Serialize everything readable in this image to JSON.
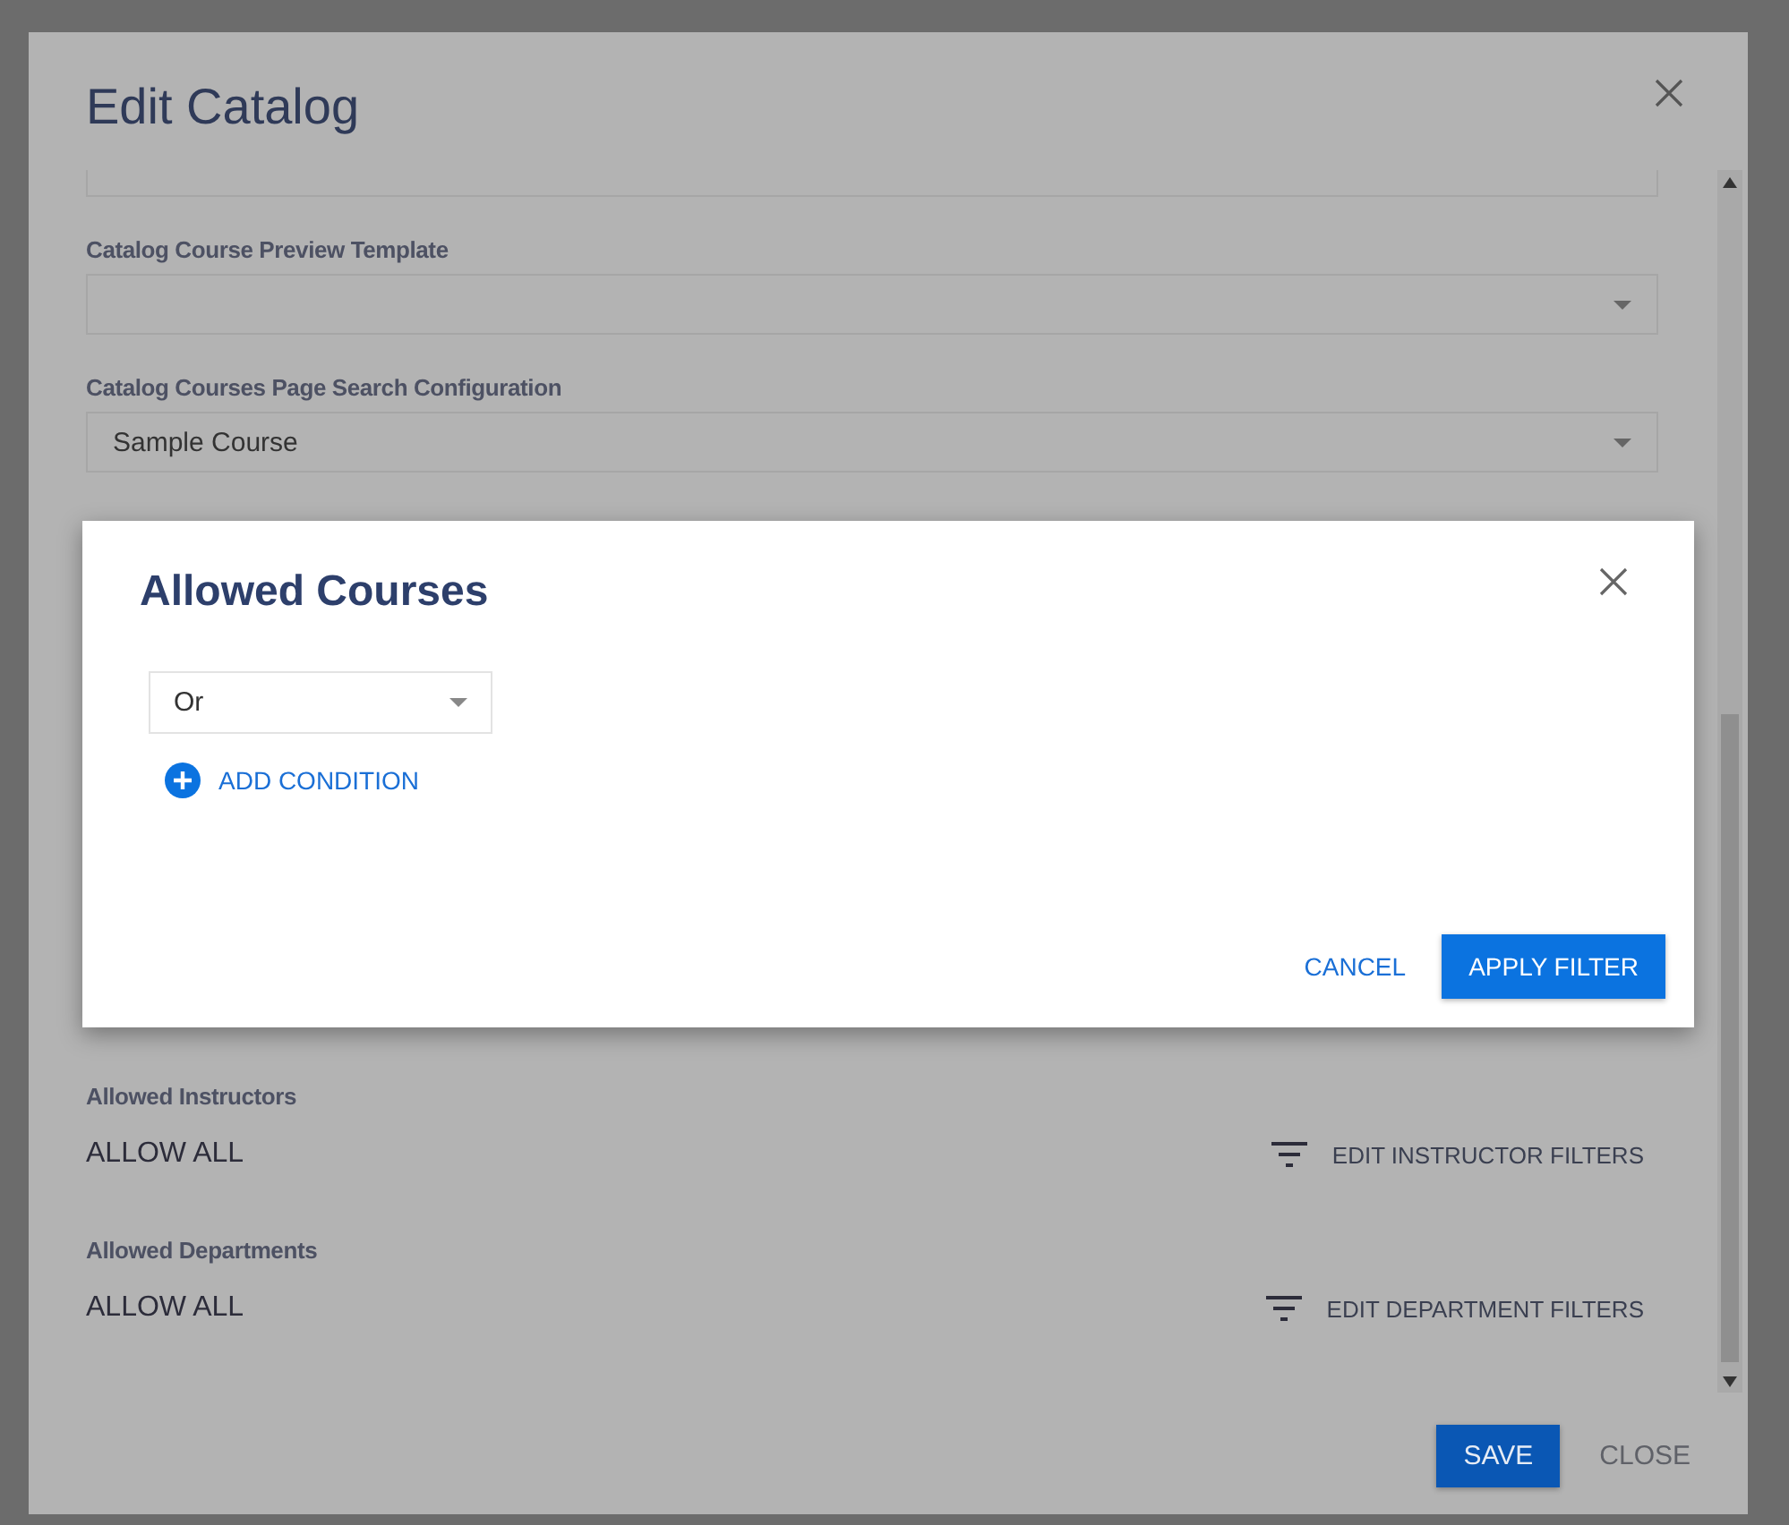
{
  "edit_catalog": {
    "title": "Edit Catalog",
    "fields": [
      {
        "label": "Catalog Course Preview Template"
      },
      {
        "label": "Catalog Courses Page Search Configuration",
        "value": "Sample Course"
      }
    ],
    "filter_rows": [
      {
        "label": "Allowed Instructors",
        "value": "ALLOW ALL",
        "action": "EDIT INSTRUCTOR FILTERS"
      },
      {
        "label": "Allowed Departments",
        "value": "ALLOW ALL",
        "action": "EDIT DEPARTMENT FILTERS"
      }
    ],
    "buttons": [
      {
        "label": "SAVE",
        "kind": "primary"
      },
      {
        "label": "CLOSE",
        "kind": "text"
      }
    ]
  },
  "allowed_courses": {
    "title": "Allowed Courses",
    "operator": {
      "value": "Or"
    },
    "add_condition": "ADD CONDITION",
    "buttons": [
      {
        "label": "CANCEL",
        "kind": "text"
      },
      {
        "label": "APPLY FILTER",
        "kind": "primary"
      }
    ]
  }
}
